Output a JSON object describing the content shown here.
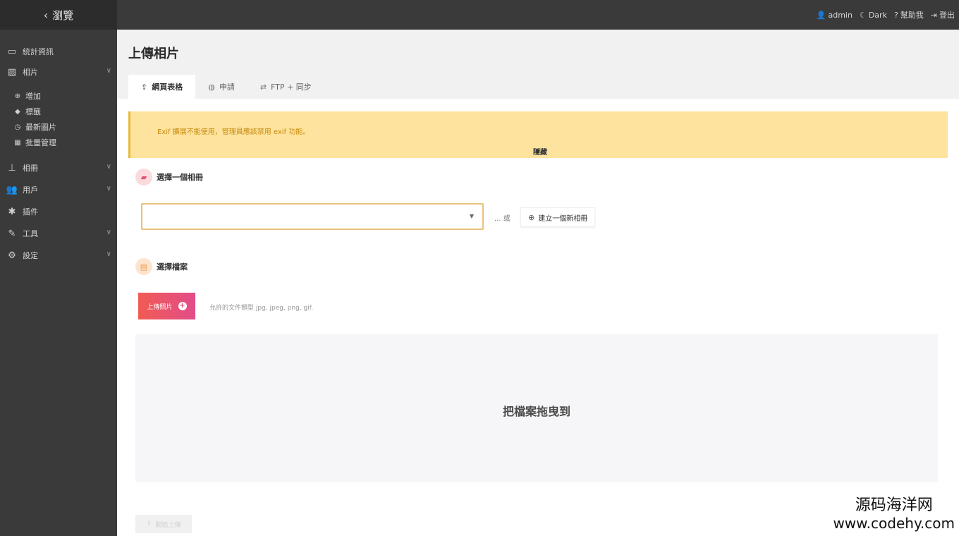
{
  "topbar": {
    "brand": "瀏覽",
    "nav": [
      {
        "icon": "user-icon",
        "label": "admin"
      },
      {
        "icon": "moon-icon",
        "label": "Dark"
      },
      {
        "icon": "help-icon",
        "label": "幫助我"
      },
      {
        "icon": "logout-icon",
        "label": "登出"
      }
    ]
  },
  "sidebar": {
    "items": [
      {
        "icon": "monitor-icon",
        "label": "統計資訊"
      },
      {
        "icon": "image-icon",
        "label": "相片"
      },
      {
        "icon": "sitemap-icon",
        "label": "相冊"
      },
      {
        "icon": "users-icon",
        "label": "用戶"
      },
      {
        "icon": "puzzle-icon",
        "label": "插件"
      },
      {
        "icon": "wrench-icon",
        "label": "工具"
      },
      {
        "icon": "gears-icon",
        "label": "設定"
      }
    ],
    "subitems": [
      {
        "icon": "plus-circle-icon",
        "label": "增加"
      },
      {
        "icon": "tags-icon",
        "label": "標籤"
      },
      {
        "icon": "clock-icon",
        "label": "最新圖片"
      },
      {
        "icon": "grid-icon",
        "label": "批量管理"
      }
    ]
  },
  "main": {
    "title": "上傳相片",
    "tabs": [
      {
        "label": "網頁表格",
        "active": true
      },
      {
        "label": "申請",
        "active": false
      },
      {
        "label": "FTP + 同步",
        "active": false
      }
    ],
    "warning": {
      "text": "Exif 擴展不能使用，管理員應該禁用 exif 功能。",
      "hide": "隱藏"
    },
    "album_section": "選擇一個相冊",
    "or_text": "... 或",
    "create_album": "建立一個新相冊",
    "files_section": "選擇檔案",
    "upload_button": "上傳照片",
    "allowed_types": "允許的文件類型 jpg, jpeg, png, gif.",
    "dropzone_text": "把檔案拖曳到",
    "start_upload": "開始上傳"
  },
  "watermark": {
    "line1": "源码海洋网",
    "line2": "www.codehy.com"
  },
  "colors": {
    "topbar": "#3a3a3a",
    "sidebar": "#3a3a3a",
    "warning_bg": "#fde39d",
    "warning_text": "#c98a0d",
    "upload_gradient_start": "#f15b53",
    "upload_gradient_end": "#e24d8a"
  }
}
